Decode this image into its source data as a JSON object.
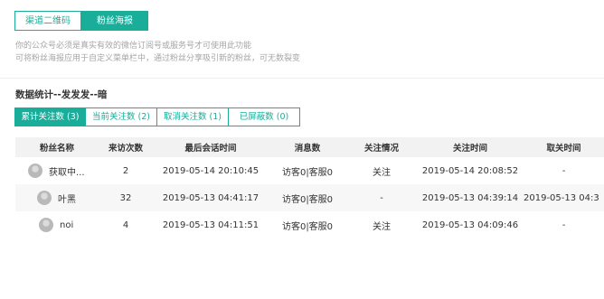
{
  "tabs": {
    "channel_qrcode": "渠道二维码",
    "fans_poster": "粉丝海报"
  },
  "description": {
    "line1": "你的公众号必须是真实有效的微信订阅号或服务号才可使用此功能",
    "line2": "可将粉丝海报应用于自定义菜单栏中，通过粉丝分享吸引新的粉丝，可无数裂变"
  },
  "section_title": "数据统计--发发发--暗",
  "subtabs": [
    {
      "label": "累计关注数 (3)"
    },
    {
      "label": "当前关注数 (2)"
    },
    {
      "label": "取消关注数 (1)"
    },
    {
      "label": "已屏蔽数 (0)"
    }
  ],
  "table": {
    "headers": [
      "粉丝名称",
      "来访次数",
      "最后会话时间",
      "消息数",
      "关注情况",
      "关注时间",
      "取关时间"
    ],
    "rows": [
      {
        "name": "获取中...",
        "visits": "2",
        "last_session": "2019-05-14 20:10:45",
        "messages": "访客0|客服0",
        "status": "关注",
        "follow_time": "2019-05-14 20:08:52",
        "unfollow_time": "-"
      },
      {
        "name": "叶黑",
        "visits": "32",
        "last_session": "2019-05-13 04:41:17",
        "messages": "访客0|客服0",
        "status": "-",
        "follow_time": "2019-05-13 04:39:14",
        "unfollow_time": "2019-05-13 04:3"
      },
      {
        "name": "noi",
        "visits": "4",
        "last_session": "2019-05-13 04:11:51",
        "messages": "访客0|客服0",
        "status": "关注",
        "follow_time": "2019-05-13 04:09:46",
        "unfollow_time": "-"
      }
    ]
  },
  "colors": {
    "accent": "#1aad9a"
  },
  "icons": {
    "avatar": "user-avatar-icon"
  }
}
